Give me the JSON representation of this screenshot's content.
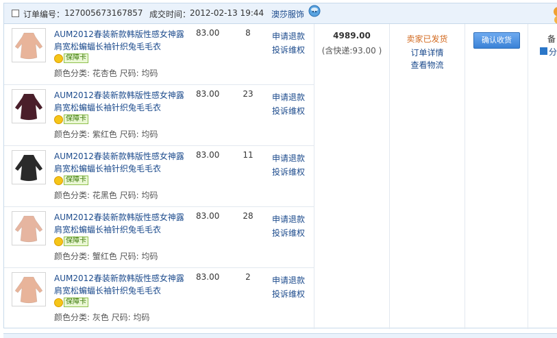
{
  "header": {
    "order_label": "订单编号：",
    "order_number": "127005673167857",
    "time_label": "成交时间：",
    "time": "2012-02-13 19:44",
    "shop": "澳莎服饰",
    "wangwang_icon": "wangwang-chat-icon"
  },
  "items": [
    {
      "title": "AUM2012春装新款韩版性感女神露肩宽松蝙蝠长袖针织兔毛毛衣",
      "badge": "保障卡",
      "sku": "颜色分类: 花杏色 尺码: 均码",
      "price": "83.00",
      "qty": "8",
      "action1": "申请退款",
      "action2": "投诉维权",
      "color": "#e8b49a"
    },
    {
      "title": "AUM2012春装新款韩版性感女神露肩宽松蝙蝠长袖针织兔毛毛衣",
      "badge": "保障卡",
      "sku": "颜色分类: 紫红色 尺码: 均码",
      "price": "83.00",
      "qty": "23",
      "action1": "申请退款",
      "action2": "投诉维权",
      "color": "#4a1e2a"
    },
    {
      "title": "AUM2012春装新款韩版性感女神露肩宽松蝙蝠长袖针织兔毛毛衣",
      "badge": "保障卡",
      "sku": "颜色分类: 花黑色 尺码: 均码",
      "price": "83.00",
      "qty": "11",
      "action1": "申请退款",
      "action2": "投诉维权",
      "color": "#2a2a2a"
    },
    {
      "title": "AUM2012春装新款韩版性感女神露肩宽松蝙蝠长袖针织兔毛毛衣",
      "badge": "保障卡",
      "sku": "颜色分类: 蟹红色 尺码: 均码",
      "price": "83.00",
      "qty": "28",
      "action1": "申请退款",
      "action2": "投诉维权",
      "color": "#e6b5a0"
    },
    {
      "title": "AUM2012春装新款韩版性感女神露肩宽松蝙蝠长袖针织兔毛毛衣",
      "badge": "保障卡",
      "sku": "颜色分类: 灰色 尺码: 均码",
      "price": "83.00",
      "qty": "2",
      "action1": "申请退款",
      "action2": "投诉维权",
      "color": "#e8b49a"
    }
  ],
  "summary": {
    "total": "4989.00",
    "shipping": "(含快递:93.00 )",
    "status": "卖家已发货",
    "detail_link": "订单详情",
    "logistics_link": "查看物流",
    "confirm_button": "确认收货",
    "memo": "备",
    "share": "分"
  }
}
